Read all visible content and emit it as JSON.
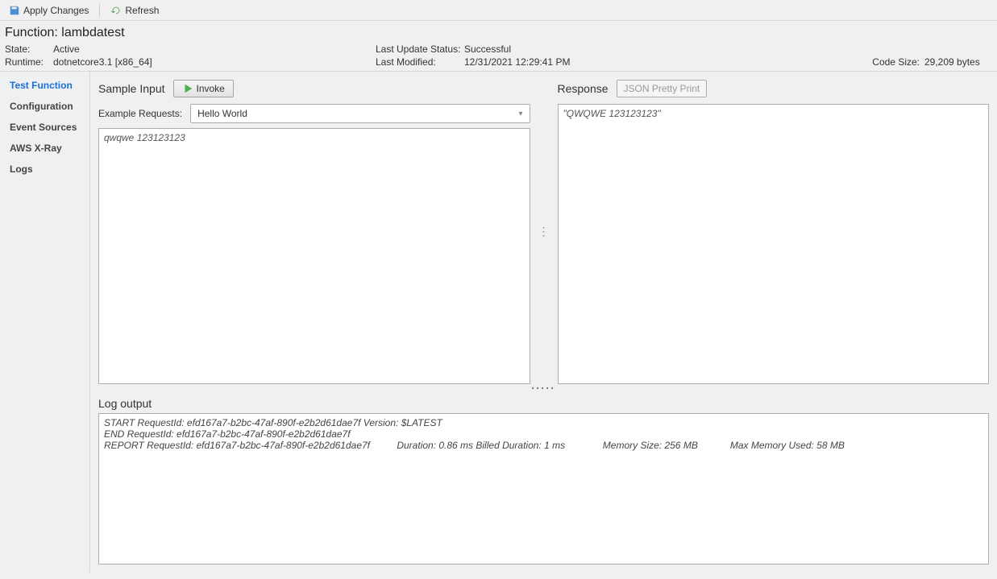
{
  "toolbar": {
    "apply": "Apply Changes",
    "refresh": "Refresh"
  },
  "function": {
    "title": "Function: lambdatest",
    "state_label": "State:",
    "state_value": "Active",
    "runtime_label": "Runtime:",
    "runtime_value": "dotnetcore3.1   [x86_64]",
    "last_status_label": "Last Update Status:",
    "last_status_value": "Successful",
    "last_mod_label": "Last Modified:",
    "last_mod_value": "12/31/2021 12:29:41 PM",
    "code_size_label": "Code Size:",
    "code_size_value": "29,209 bytes"
  },
  "sidebar": {
    "items": [
      {
        "label": "Test Function"
      },
      {
        "label": "Configuration"
      },
      {
        "label": "Event Sources"
      },
      {
        "label": "AWS X-Ray"
      },
      {
        "label": "Logs"
      }
    ]
  },
  "sample_input": {
    "title": "Sample Input",
    "invoke_label": "Invoke",
    "example_label": "Example Requests:",
    "example_value": "Hello World",
    "body": "qwqwe 123123123"
  },
  "response": {
    "title": "Response",
    "pretty_label": "JSON Pretty Print",
    "body": "\"QWQWE 123123123\""
  },
  "log": {
    "title": "Log output",
    "body": "START RequestId: efd167a7-b2bc-47af-890f-e2b2d61dae7f Version: $LATEST\nEND RequestId: efd167a7-b2bc-47af-890f-e2b2d61dae7f\nREPORT RequestId: efd167a7-b2bc-47af-890f-e2b2d61dae7f          Duration: 0.86 ms Billed Duration: 1 ms              Memory Size: 256 MB            Max Memory Used: 58 MB"
  }
}
